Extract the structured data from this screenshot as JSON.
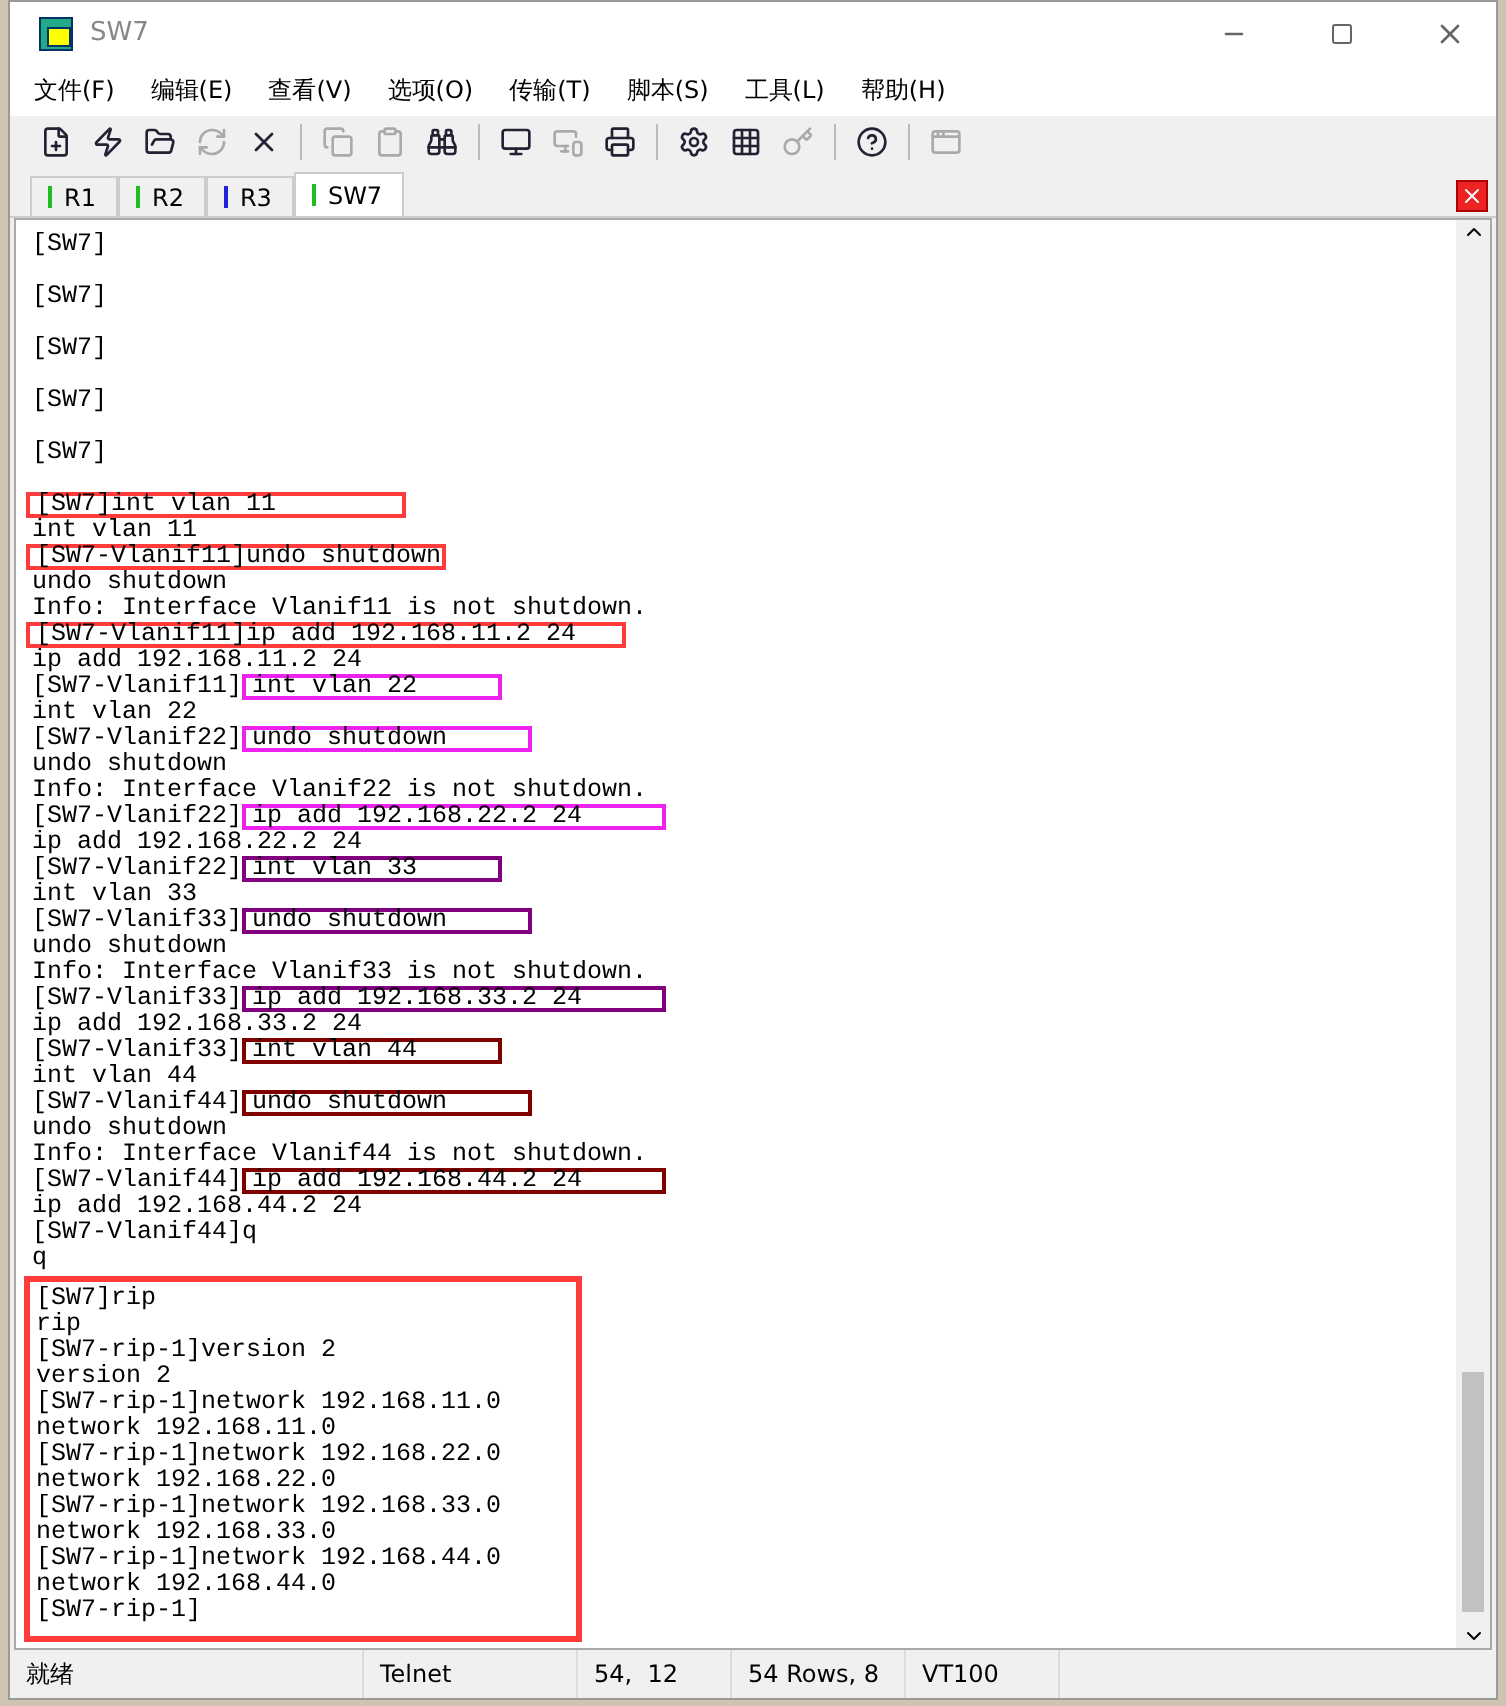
{
  "window": {
    "title": "SW7"
  },
  "menu": [
    "文件(F)",
    "编辑(E)",
    "查看(V)",
    "选项(O)",
    "传输(T)",
    "脚本(S)",
    "工具(L)",
    "帮助(H)"
  ],
  "toolbar": [
    [
      {
        "disabled": false
      },
      {
        "disabled": false
      },
      {
        "disabled": false
      },
      {
        "disabled": true
      },
      {
        "disabled": false
      }
    ],
    [
      {
        "disabled": true
      },
      {
        "disabled": true
      },
      {
        "disabled": false
      }
    ],
    [
      {
        "disabled": false
      },
      {
        "disabled": true
      },
      {
        "disabled": false
      }
    ],
    [
      {
        "disabled": false
      },
      {
        "disabled": false
      },
      {
        "disabled": true
      }
    ],
    [
      {
        "disabled": false
      }
    ],
    [
      {
        "disabled": true
      }
    ]
  ],
  "tabs": [
    {
      "label": "R1",
      "color": "#22bb22",
      "selected": false
    },
    {
      "label": "R2",
      "color": "#22bb22",
      "selected": false
    },
    {
      "label": "R3",
      "color": "#2222dd",
      "selected": false
    },
    {
      "label": "SW7",
      "color": "#22bb22",
      "selected": true
    }
  ],
  "terminal": {
    "blocks": [
      {
        "lines": [
          {
            "text": "[SW7]",
            "kind": "spaced"
          },
          {
            "text": "[SW7]",
            "kind": "spaced"
          },
          {
            "text": "[SW7]",
            "kind": "spaced"
          },
          {
            "text": "[SW7]",
            "kind": "spaced"
          },
          {
            "text": "[SW7]",
            "kind": "spaced"
          },
          {
            "prompt": "[SW7]",
            "command": "int vlan 11",
            "kind": "boxed_line",
            "color": "#ff3b3b"
          },
          {
            "text": "int vlan 11"
          },
          {
            "prompt": "[SW7-Vlanif11]",
            "command": "undo shutdown",
            "kind": "boxed_line",
            "color": "#ff3b3b"
          },
          {
            "text": "undo shutdown"
          },
          {
            "text": "Info: Interface Vlanif11 is not shutdown."
          },
          {
            "prompt": "[SW7-Vlanif11]",
            "command": "ip add 192.168.11.2 24",
            "kind": "boxed_line",
            "color": "#ff3b3b"
          },
          {
            "text": "ip add 192.168.11.2 24"
          },
          {
            "prompt": "[SW7-Vlanif11]",
            "command": "int vlan 22",
            "kind": "boxed_command",
            "color": "#ee22ee"
          },
          {
            "text": "int vlan 22"
          },
          {
            "prompt": "[SW7-Vlanif22]",
            "command": "undo shutdown",
            "kind": "boxed_command",
            "color": "#ee22ee"
          },
          {
            "text": "undo shutdown"
          },
          {
            "text": "Info: Interface Vlanif22 is not shutdown."
          },
          {
            "prompt": "[SW7-Vlanif22]",
            "command": "ip add 192.168.22.2 24",
            "kind": "boxed_command",
            "color": "#ee22ee"
          },
          {
            "text": "ip add 192.168.22.2 24"
          },
          {
            "prompt": "[SW7-Vlanif22]",
            "command": "int vlan 33",
            "kind": "boxed_command",
            "color": "#800080"
          },
          {
            "text": "int vlan 33"
          },
          {
            "prompt": "[SW7-Vlanif33]",
            "command": "undo shutdown",
            "kind": "boxed_command",
            "color": "#800080"
          },
          {
            "text": "undo shutdown"
          },
          {
            "text": "Info: Interface Vlanif33 is not shutdown."
          },
          {
            "prompt": "[SW7-Vlanif33]",
            "command": "ip add 192.168.33.2 24",
            "kind": "boxed_command",
            "color": "#800080"
          },
          {
            "text": "ip add 192.168.33.2 24"
          },
          {
            "prompt": "[SW7-Vlanif33]",
            "command": "int vlan 44",
            "kind": "boxed_command",
            "color": "#800000"
          },
          {
            "text": "int vlan 44"
          },
          {
            "prompt": "[SW7-Vlanif44]",
            "command": "undo shutdown",
            "kind": "boxed_command",
            "color": "#800000"
          },
          {
            "text": "undo shutdown"
          },
          {
            "text": "Info: Interface Vlanif44 is not shutdown."
          },
          {
            "prompt": "[SW7-Vlanif44]",
            "command": "ip add 192.168.44.2 24",
            "kind": "boxed_command",
            "color": "#800000"
          },
          {
            "text": "ip add 192.168.44.2 24"
          },
          {
            "text": "[SW7-Vlanif44]q"
          },
          {
            "text": "q"
          }
        ]
      },
      {
        "color": "#ff3b3b",
        "lines": [
          {
            "text": "[SW7]rip"
          },
          {
            "text": "rip"
          },
          {
            "text": "[SW7-rip-1]version 2"
          },
          {
            "text": "version 2"
          },
          {
            "text": "[SW7-rip-1]network 192.168.11.0"
          },
          {
            "text": "network 192.168.11.0"
          },
          {
            "text": "[SW7-rip-1]network 192.168.22.0"
          },
          {
            "text": "network 192.168.22.0"
          },
          {
            "text": "[SW7-rip-1]network 192.168.33.0"
          },
          {
            "text": "network 192.168.33.0"
          },
          {
            "text": "[SW7-rip-1]network 192.168.44.0"
          },
          {
            "text": "network 192.168.44.0"
          },
          {
            "text": "[SW7-rip-1]"
          }
        ]
      }
    ]
  },
  "status_bar": [
    "就绪",
    "Telnet",
    "54,  12",
    "54 Rows, 8",
    "VT100"
  ]
}
